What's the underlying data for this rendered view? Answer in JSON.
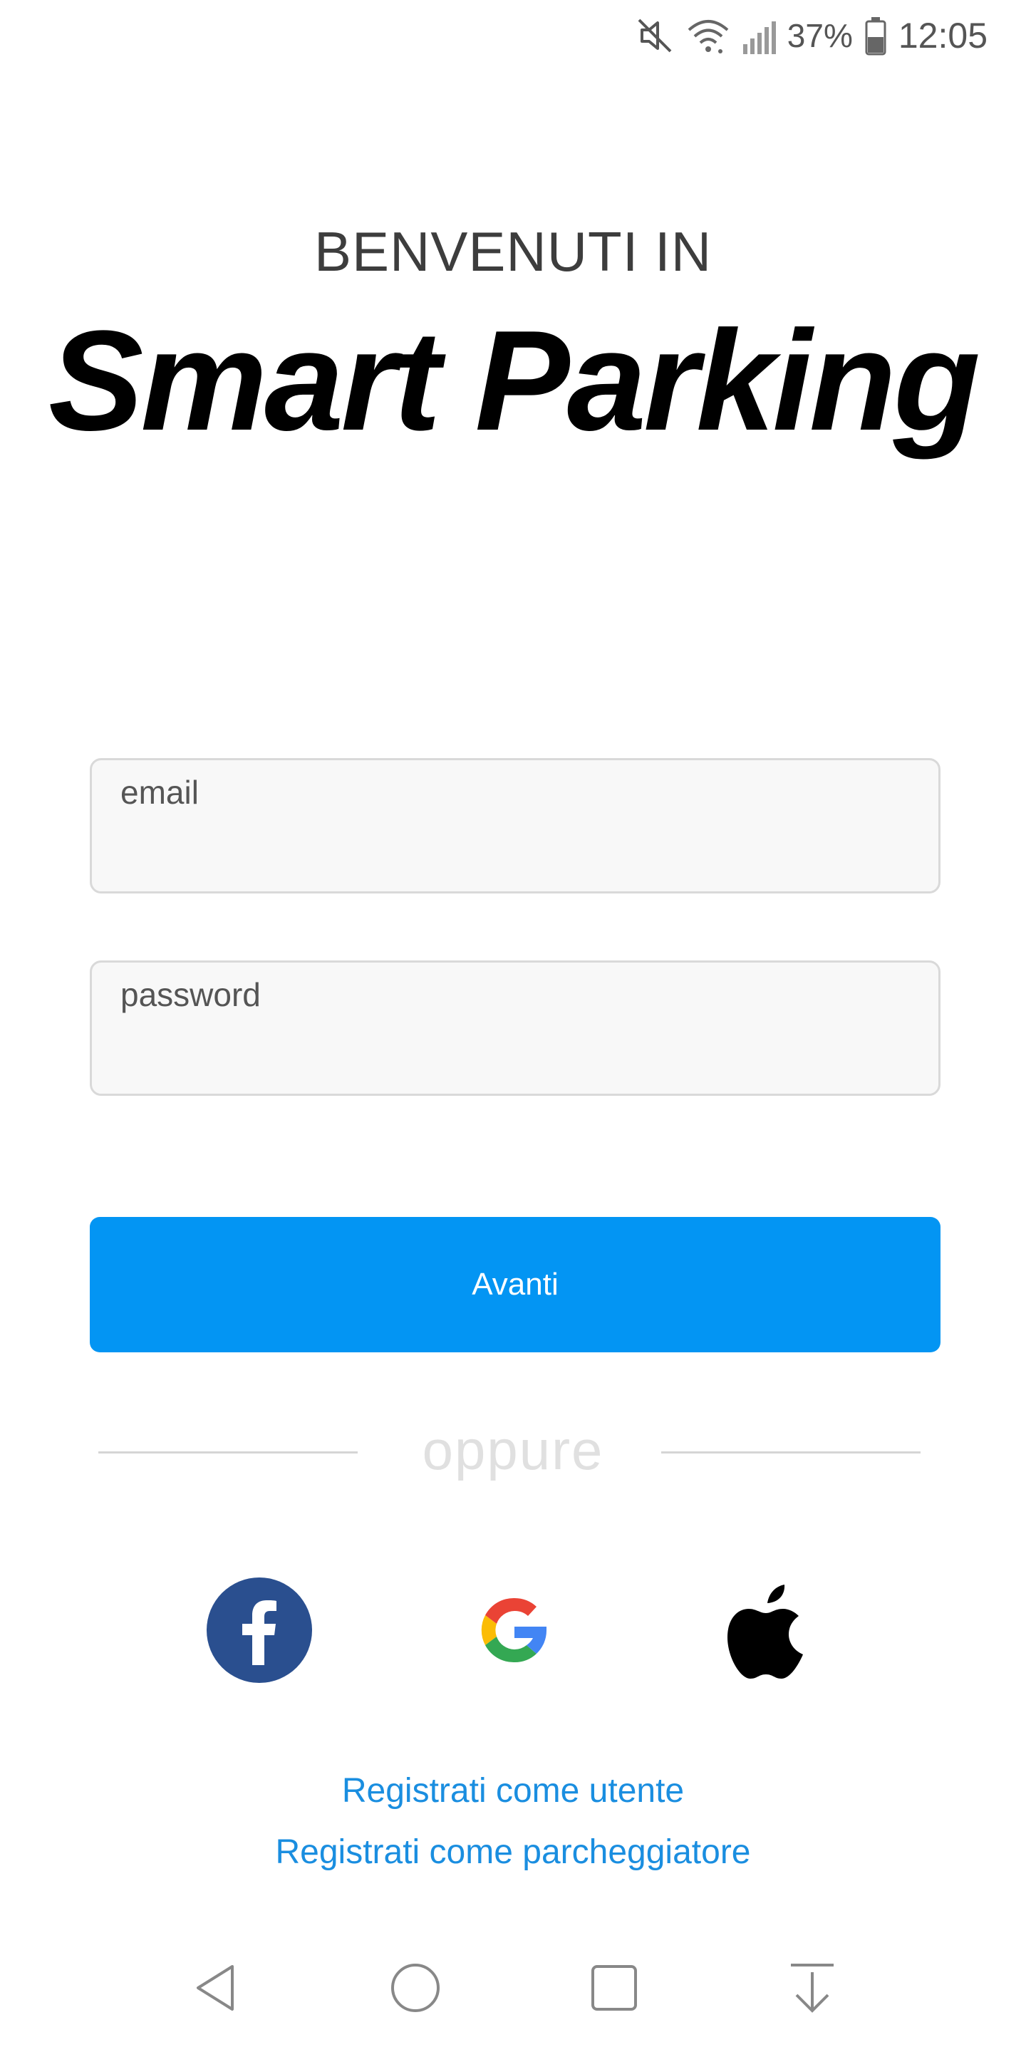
{
  "status_bar": {
    "battery_percent": "37%",
    "time": "12:05",
    "icons": [
      "mute-icon",
      "wifi-icon",
      "signal-icon",
      "battery-icon"
    ]
  },
  "header": {
    "welcome": "BENVENUTI IN",
    "brand": "Smart Parking"
  },
  "form": {
    "email_placeholder": "email",
    "password_placeholder": "password",
    "email_value": "",
    "password_value": "",
    "submit_label": "Avanti",
    "submit_color": "#0395f3"
  },
  "divider": {
    "label": "oppure"
  },
  "social_login": {
    "items": [
      "facebook-icon",
      "google-icon",
      "apple-icon"
    ],
    "facebook_color": "#2a4f8f"
  },
  "links": {
    "register_user": "Registrati come utente",
    "register_parker": "Registrati come parcheggiatore",
    "link_color": "#1a8ee0"
  },
  "nav_bar": {
    "items": [
      "back-icon",
      "home-icon",
      "recents-icon",
      "notification-pull-icon"
    ]
  }
}
